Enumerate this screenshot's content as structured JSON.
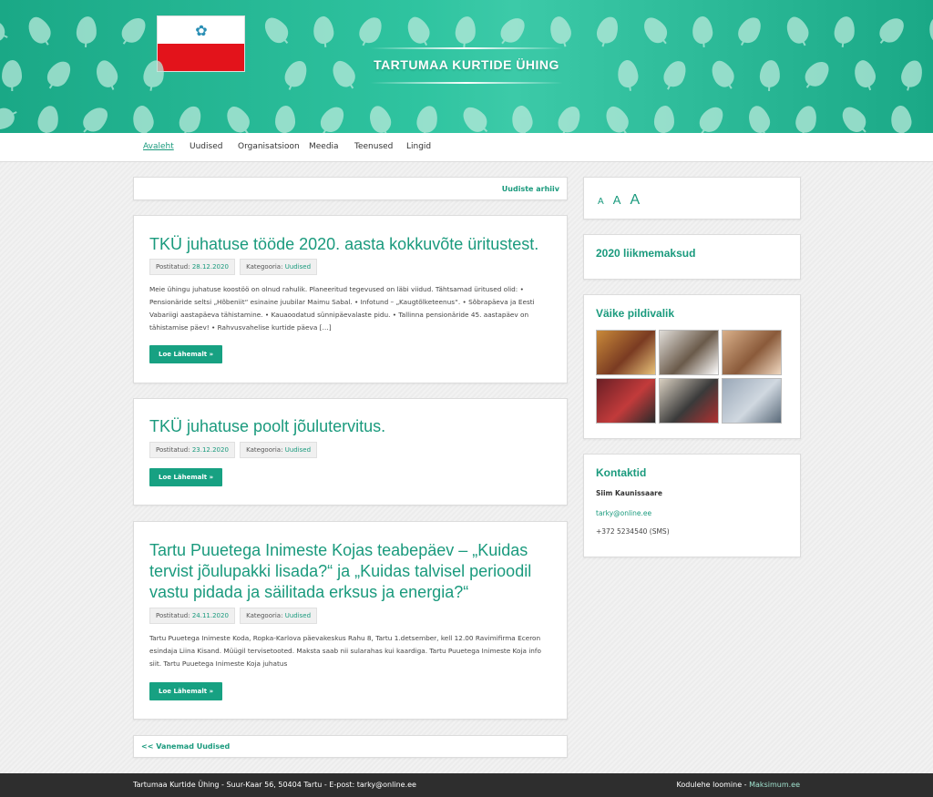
{
  "header": {
    "site_title": "TARTUMAA KURTIDE ÜHING",
    "brand_color": "#1aa886"
  },
  "nav": {
    "items": [
      {
        "label": "Avaleht",
        "active": true
      },
      {
        "label": "Uudised",
        "active": false
      },
      {
        "label": "Organisatsioon",
        "active": false
      },
      {
        "label": "Meedia",
        "active": false
      },
      {
        "label": "Teenused",
        "active": false
      },
      {
        "label": "Lingid",
        "active": false
      }
    ]
  },
  "main": {
    "archive_link": "Uudiste arhiiv",
    "posts": [
      {
        "title": "TKÜ juhatuse tööde 2020. aasta kokkuvõte üritustest.",
        "posted_label": "Postitatud:",
        "date": "28.12.2020",
        "category_label": "Kategooria:",
        "category": "Uudised",
        "excerpt": "Meie ühingu juhatuse koostöö on olnud rahulik. Planeeritud tegevused on läbi viidud. Tähtsamad üritused olid: • Pensionäride seltsi „Hõbeniit“ esinaine juubilar Maimu Sabal. • Infotund – „Kaugtõlketeenus“. • Sõbrapäeva ja Eesti Vabariigi aastapäeva tähistamine. • Kauaoodatud sünnipäevalaste pidu. • Tallinna pensionäride 45. aastapäev on tähistamise päev! • Rahvusvahelise kurtide päeva […]",
        "read_more": "Loe Lähemalt »"
      },
      {
        "title": "TKÜ juhatuse poolt jõulutervitus.",
        "posted_label": "Postitatud:",
        "date": "23.12.2020",
        "category_label": "Kategooria:",
        "category": "Uudised",
        "excerpt": "",
        "read_more": "Loe Lähemalt »"
      },
      {
        "title": "Tartu Puuetega Inimeste Kojas teabepäev – „Kuidas tervist jõulupakki lisada?“ ja „Kuidas talvisel perioodil vastu pidada ja säilitada erksus ja energia?“",
        "posted_label": "Postitatud:",
        "date": "24.11.2020",
        "category_label": "Kategooria:",
        "category": "Uudised",
        "excerpt": "Tartu Puuetega Inimeste Koda, Ropka-Karlova päevakeskus Rahu 8, Tartu 1.detsember, kell 12.00 Ravimifirma Eceron esindaja Liina Kisand. Müügil tervisetooted. Maksta saab nii sularahas kui kaardiga. Tartu Puuetega Inimeste Koja info siit. Tartu Puuetega Inimeste Koja juhatus",
        "read_more": "Loe Lähemalt »"
      }
    ],
    "older_link": "<< Vanemad Uudised"
  },
  "sidebar": {
    "font_sizes": [
      "A",
      "A",
      "A"
    ],
    "membership_title": "2020 liikmemaksud",
    "gallery_title": "Väike pildivalik",
    "gallery_thumbs": [
      {
        "colors": [
          "#c98a3a",
          "#7a3b22",
          "#e8c27a"
        ]
      },
      {
        "colors": [
          "#e0ddd8",
          "#6a5a4a",
          "#ffffff"
        ]
      },
      {
        "colors": [
          "#d9b08a",
          "#8a5a3a",
          "#f0d8c0"
        ]
      },
      {
        "colors": [
          "#6a1f25",
          "#c23b3b",
          "#2a2a2a"
        ]
      },
      {
        "colors": [
          "#d8cfc0",
          "#3a3a3a",
          "#b03030"
        ]
      },
      {
        "colors": [
          "#9aa8b8",
          "#d0d8e0",
          "#5a6a7a"
        ]
      }
    ],
    "contact_title": "Kontaktid",
    "contact_name": "Siim Kaunissaare",
    "contact_email": "tarky@online.ee",
    "contact_phone": "+372 5234540 (SMS)"
  },
  "footer": {
    "left": "Tartumaa Kurtide Ühing - Suur-Kaar 56, 50404 Tartu - E-post: tarky@online.ee",
    "right_label": "Kodulehe loomine -",
    "right_link": "Maksimum.ee"
  }
}
